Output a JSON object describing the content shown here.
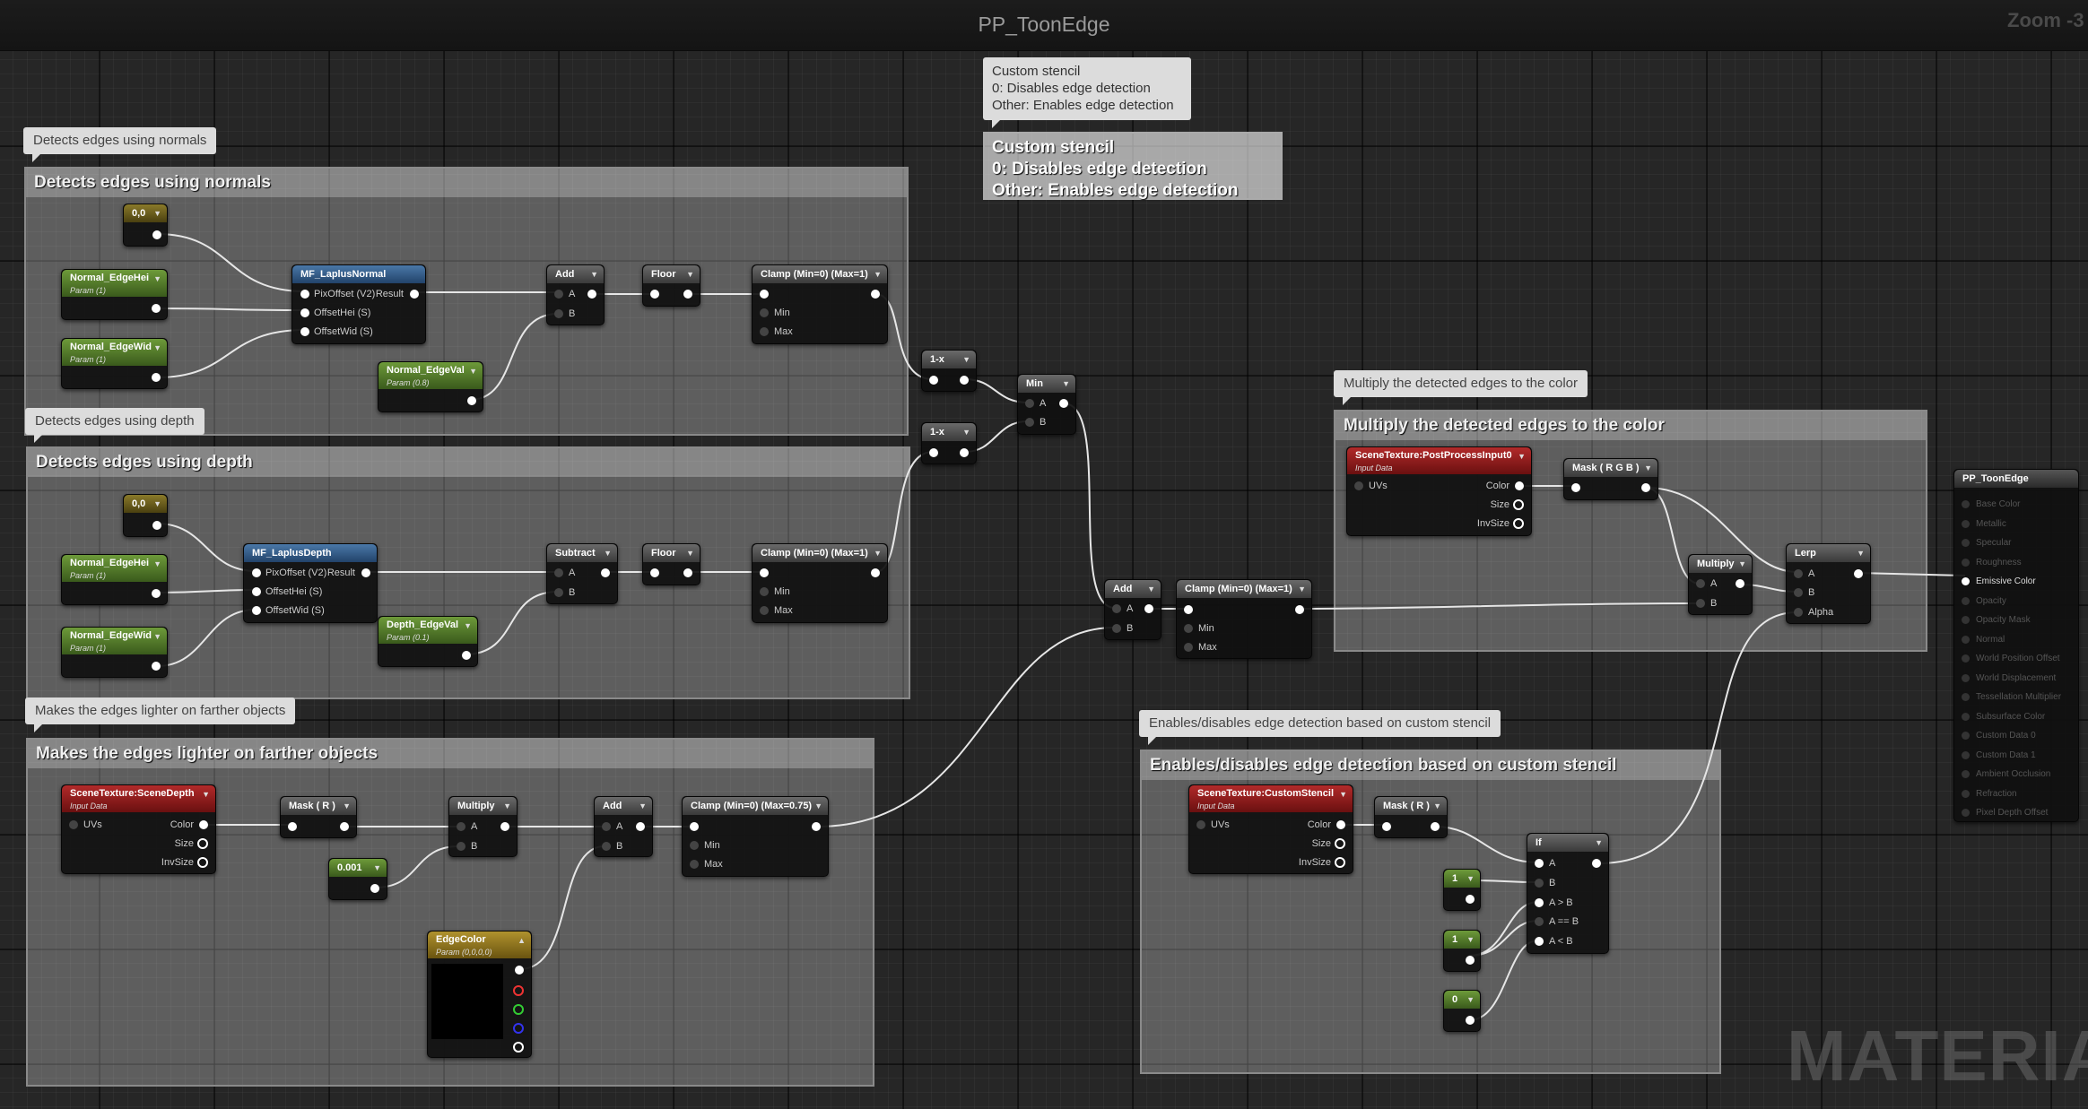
{
  "graph": {
    "title": "PP_ToonEdge",
    "zoom": "Zoom -3",
    "watermark": "MATERIAL"
  },
  "colors": {
    "comment_fill": "#ffffff42",
    "param_green": "#6d9a3a",
    "constant_yellow": "#8a7a2a",
    "function_blue": "#4a78a8",
    "scene_texture_red": "#b22a2a",
    "vector_param_gold": "#b0922e"
  },
  "comments": {
    "normals": "Detects edges using normals",
    "depth": "Detects edges using depth",
    "farther": "Makes the edges lighter on farther objects",
    "multiply": "Multiply the detected edges to the color",
    "stencil": "Enables/disables edge detection based on custom stencil"
  },
  "stencil_note": {
    "line1": "Custom stencil",
    "line2": "0: Disables edge detection",
    "line3": "Other: Enables edge detection"
  },
  "nodes": {
    "const_00_a": {
      "title": "0,0"
    },
    "normal_edgehei_a": {
      "title": "Normal_EdgeHei",
      "sub": "Param (1)"
    },
    "normal_edgewid_a": {
      "title": "Normal_EdgeWid",
      "sub": "Param (1)"
    },
    "mf_laplus_normal": {
      "title": "MF_LaplusNormal",
      "pins": [
        "PixOffset (V2)",
        "OffsetHei (S)",
        "OffsetWid (S)"
      ],
      "out": "Result"
    },
    "normal_edgeval": {
      "title": "Normal_EdgeVal",
      "sub": "Param (0.8)"
    },
    "add_a": {
      "title": "Add"
    },
    "floor_a": {
      "title": "Floor"
    },
    "clamp_a": {
      "title": "Clamp (Min=0) (Max=1)"
    },
    "const_00_b": {
      "title": "0,0"
    },
    "normal_edgehei_b": {
      "title": "Normal_EdgeHei",
      "sub": "Param (1)"
    },
    "normal_edgewid_b": {
      "title": "Normal_EdgeWid",
      "sub": "Param (1)"
    },
    "mf_laplus_depth": {
      "title": "MF_LaplusDepth",
      "pins": [
        "PixOffset (V2)",
        "OffsetHei (S)",
        "OffsetWid (S)"
      ],
      "out": "Result"
    },
    "depth_edgeval": {
      "title": "Depth_EdgeVal",
      "sub": "Param (0.1)"
    },
    "subtract": {
      "title": "Subtract"
    },
    "floor_b": {
      "title": "Floor"
    },
    "clamp_b": {
      "title": "Clamp (Min=0) (Max=1)"
    },
    "one_minus_a": {
      "title": "1-x"
    },
    "one_minus_b": {
      "title": "1-x"
    },
    "min": {
      "title": "Min"
    },
    "add_mid": {
      "title": "Add"
    },
    "clamp_mid": {
      "title": "Clamp (Min=0) (Max=1)"
    },
    "scene_postprocess": {
      "title": "SceneTexture:PostProcessInput0",
      "sub": "Input Data",
      "outs": [
        "Color",
        "Size",
        "InvSize"
      ]
    },
    "mask_rgb": {
      "title": "Mask ( R G B )"
    },
    "multiply_right": {
      "title": "Multiply"
    },
    "lerp": {
      "title": "Lerp",
      "alpha": "Alpha"
    },
    "scene_depth": {
      "title": "SceneTexture:SceneDepth",
      "sub": "Input Data",
      "outs": [
        "Color",
        "Size",
        "InvSize"
      ]
    },
    "mask_r_a": {
      "title": "Mask ( R )"
    },
    "multiply_low": {
      "title": "Multiply"
    },
    "const_001": {
      "title": "0.001"
    },
    "add_low": {
      "title": "Add"
    },
    "clamp_low": {
      "title": "Clamp (Min=0) (Max=0.75)"
    },
    "edge_color": {
      "title": "EdgeColor",
      "sub": "Param (0,0,0,0)"
    },
    "scene_stencil": {
      "title": "SceneTexture:CustomStencil",
      "sub": "Input Data",
      "outs": [
        "Color",
        "Size",
        "InvSize"
      ]
    },
    "mask_r_b": {
      "title": "Mask ( R )"
    },
    "if_node": {
      "title": "If",
      "pins": [
        "A",
        "B",
        "A > B",
        "A == B",
        "A < B"
      ]
    },
    "const_1_a": {
      "title": "1"
    },
    "const_1_b": {
      "title": "1"
    },
    "const_0": {
      "title": "0"
    }
  },
  "labels": {
    "uvs": "UVs",
    "a": "A",
    "b": "B",
    "min": "Min",
    "max": "Max"
  },
  "result_node": {
    "title": "PP_ToonEdge",
    "inputs": [
      "Base Color",
      "Metallic",
      "Specular",
      "Roughness",
      "Emissive Color",
      "Opacity",
      "Opacity Mask",
      "Normal",
      "World Position Offset",
      "World Displacement",
      "Tessellation Multiplier",
      "Subsurface Color",
      "Custom Data 0",
      "Custom Data 1",
      "Ambient Occlusion",
      "Refraction",
      "Pixel Depth Offset"
    ],
    "active_input": "Emissive Color"
  }
}
